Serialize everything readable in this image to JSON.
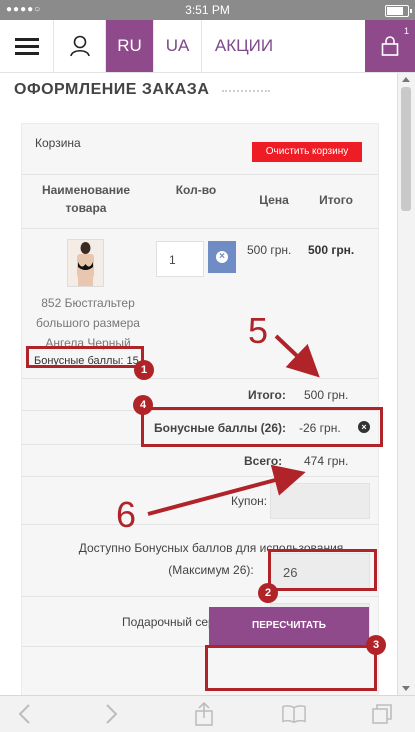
{
  "status_bar": {
    "time": "3:51 PM",
    "signal": "●●●●○"
  },
  "nav": {
    "lang_ru": "RU",
    "lang_ua": "UA",
    "promo": "АКЦИИ",
    "cart_count": "1"
  },
  "page": {
    "title": "ОФОРМЛЕНИЕ ЗАКАЗА"
  },
  "basket": {
    "label": "Корзина",
    "clear_button": "Очистить корзину",
    "columns": {
      "name": "Наименование товара",
      "qty": "Кол-во",
      "price": "Цена",
      "total": "Итого"
    },
    "item": {
      "name": "852 Бюстгальтер большого размера Ангела Черный",
      "bonus": "Бонусные баллы: 15",
      "qty": "1",
      "price": "500 грн.",
      "total": "500 грн."
    }
  },
  "summary": {
    "subtotal_label": "Итого:",
    "subtotal_value": "500 грн.",
    "bonus_label": "Бонусные баллы (26):",
    "bonus_value": "-26 грн.",
    "grand_label": "Всего:",
    "grand_value": "474 грн.",
    "coupon_label": "Купон:",
    "available_bonus_label": "Доступно Бонусных баллов для использования (Максимум 26):",
    "available_bonus_value": "26",
    "gift_label": "Подарочный сертификат:",
    "recalc_button": "ПЕРЕСЧИТАТЬ"
  },
  "annotations": {
    "badge1": "1",
    "badge2": "2",
    "badge3": "3",
    "badge4": "4",
    "num5": "5",
    "num6": "6",
    "accent_color": "#b02429"
  },
  "colors": {
    "brand": "#8e4a8b",
    "danger": "#ee1c25",
    "remove": "#6f8cc4"
  }
}
